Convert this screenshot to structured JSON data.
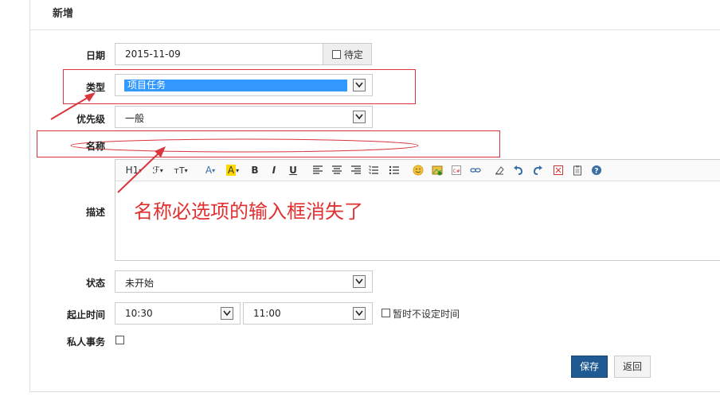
{
  "header": {
    "title": "新增"
  },
  "form": {
    "date": {
      "label": "日期",
      "value": "2015-11-09",
      "pending_label": "待定"
    },
    "type": {
      "label": "类型",
      "value": "项目任务"
    },
    "priority": {
      "label": "优先级",
      "value": "一般"
    },
    "name": {
      "label": "名称"
    },
    "description": {
      "label": "描述"
    },
    "status": {
      "label": "状态",
      "value": "未开始"
    },
    "time": {
      "label": "起止时间",
      "start": "10:30",
      "end": "11:00",
      "no_time_label": "暂时不设定时间"
    },
    "private": {
      "label": "私人事务"
    }
  },
  "toolbar": {
    "heading": "H1",
    "font_family": "ℱ",
    "font_size": "тT",
    "font_color": "A",
    "highlight": "A",
    "bold": "B",
    "italic": "I",
    "underline": "U"
  },
  "buttons": {
    "save": "保存",
    "back": "返回"
  },
  "annotation": {
    "text": "名称必选项的输入框消失了",
    "color": "#e03030"
  }
}
